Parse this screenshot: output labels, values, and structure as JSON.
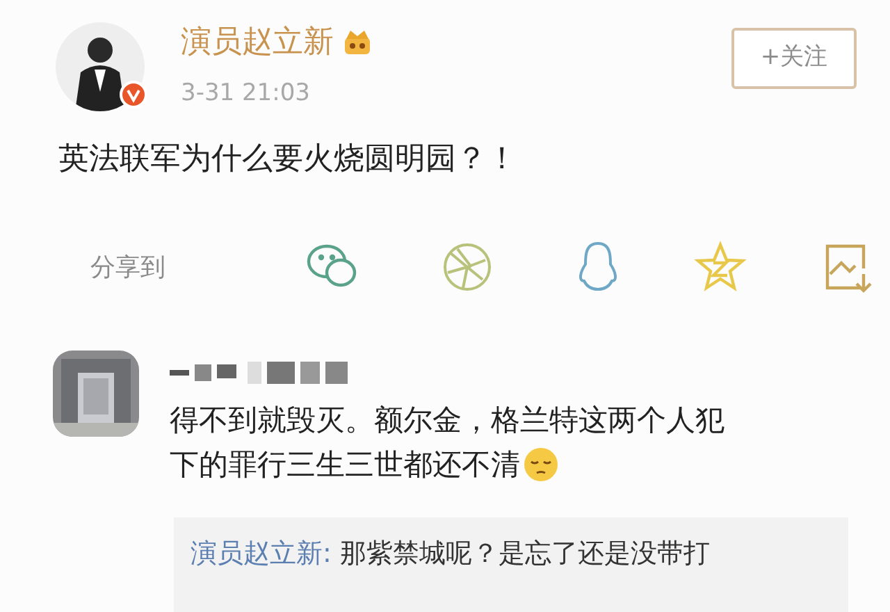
{
  "post": {
    "author": "演员赵立新",
    "time": "3-31 21:03",
    "follow_button": "+关注",
    "text": "英法联军为什么要火烧圆明园？！"
  },
  "share": {
    "label": "分享到"
  },
  "comment": {
    "lines": [
      "得不到就毁灭。额尔金，格兰特这两个人犯",
      "下的罪行三生三世都还不清"
    ],
    "reply": {
      "author": "演员赵立新:",
      "text": "那紫禁城呢？是忘了还是没带打"
    }
  }
}
